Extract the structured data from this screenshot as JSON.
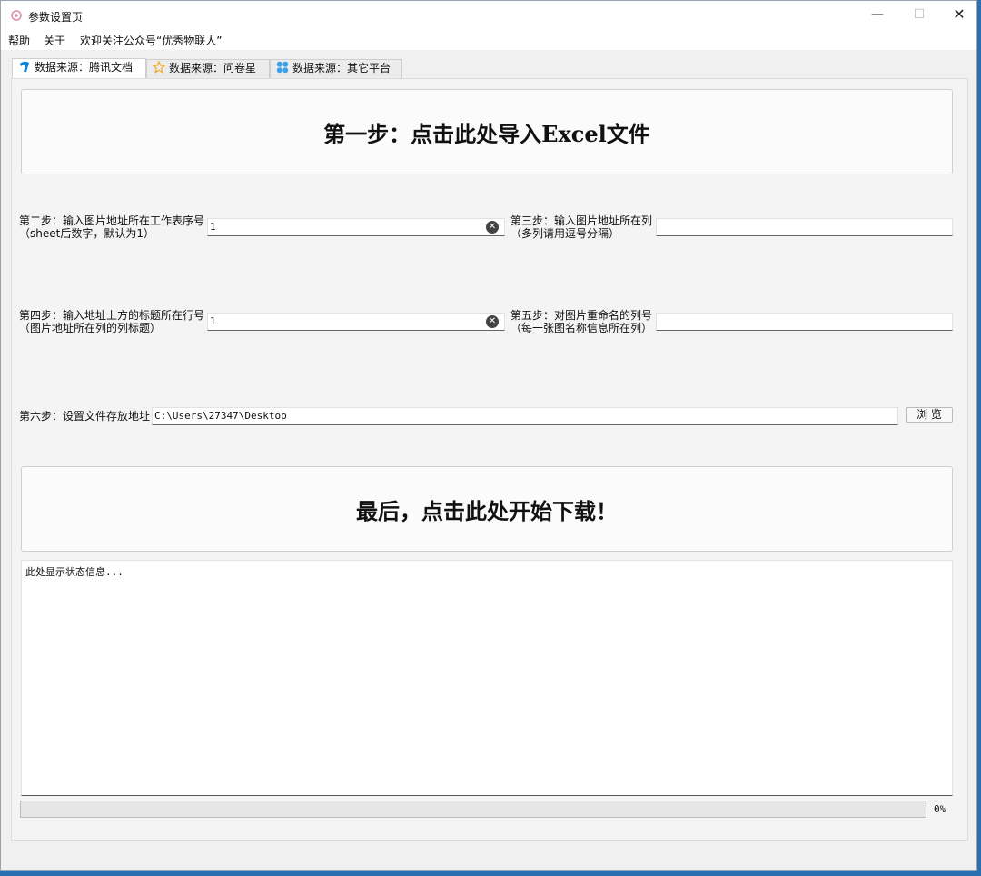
{
  "window": {
    "title": "参数设置页",
    "minimize": "—",
    "maximize": "☐",
    "close": "✕"
  },
  "menu": [
    "帮助",
    "关于",
    "欢迎关注公众号“优秀物联人”"
  ],
  "tabs": [
    {
      "label": "数据来源：腾讯文档",
      "icon": "tencent-docs-icon",
      "active": true
    },
    {
      "label": "数据来源：问卷星",
      "icon": "star-icon",
      "active": false
    },
    {
      "label": "数据来源：其它平台",
      "icon": "grid-icon",
      "active": false
    }
  ],
  "step1": {
    "label": "第一步：点击此处导入Excel文件"
  },
  "step2": {
    "line1": "第二步：输入图片地址所在工作表序号",
    "line2": "（sheet后数字，默认为1）",
    "value": "1"
  },
  "step3": {
    "line1": "第三步：输入图片地址所在列",
    "line2": "（多列请用逗号分隔）",
    "value": ""
  },
  "step4": {
    "line1": "第四步：输入地址上方的标题所在行号",
    "line2": "（图片地址所在列的列标题）",
    "value": "1"
  },
  "step5": {
    "line1": "第五步：对图片重命名的列号",
    "line2": "（每一张图名称信息所在列）",
    "value": ""
  },
  "step6": {
    "label": "第六步：设置文件存放地址",
    "value": "C:\\Users\\27347\\Desktop",
    "browse": "浏 览"
  },
  "final": {
    "label": "最后，点击此处开始下载！"
  },
  "status": {
    "text": "此处显示状态信息..."
  },
  "progress": {
    "value": 0,
    "text": "0%"
  },
  "colors": {
    "accent": "#0a84d8",
    "star": "#f5a623",
    "progress_fill": "#06b025"
  }
}
